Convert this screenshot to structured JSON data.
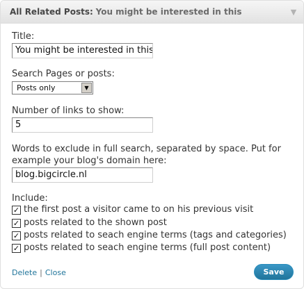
{
  "widget": {
    "title": "All Related Posts:",
    "subtitle": "You might be interested in this"
  },
  "form": {
    "title_label": "Title:",
    "title_value": "You might be interested in this",
    "search_label": "Search Pages or posts:",
    "search_selected": "Posts only",
    "links_label": "Number of links to show:",
    "links_value": "5",
    "exclude_label_line1": "Words to exclude in full search, separated by space. Put for",
    "exclude_label_line2": "example your blog's domain here:",
    "exclude_value": "blog.bigcircle.nl",
    "include_label": "Include:",
    "include_options": [
      {
        "label": "the first post a visitor came to on his previous visit",
        "checked": true
      },
      {
        "label": "posts related to the shown post",
        "checked": true
      },
      {
        "label": "posts related to seach engine terms (tags and categories)",
        "checked": true
      },
      {
        "label": "posts related to seach engine terms (full post content)",
        "checked": true
      }
    ]
  },
  "footer": {
    "delete_label": "Delete",
    "separator": "|",
    "close_label": "Close",
    "save_label": "Save"
  },
  "icons": {
    "toggle": "triangle-down-icon",
    "checkmark": "check-icon"
  },
  "colors": {
    "link": "#21759b",
    "save_button": "#21759b"
  }
}
